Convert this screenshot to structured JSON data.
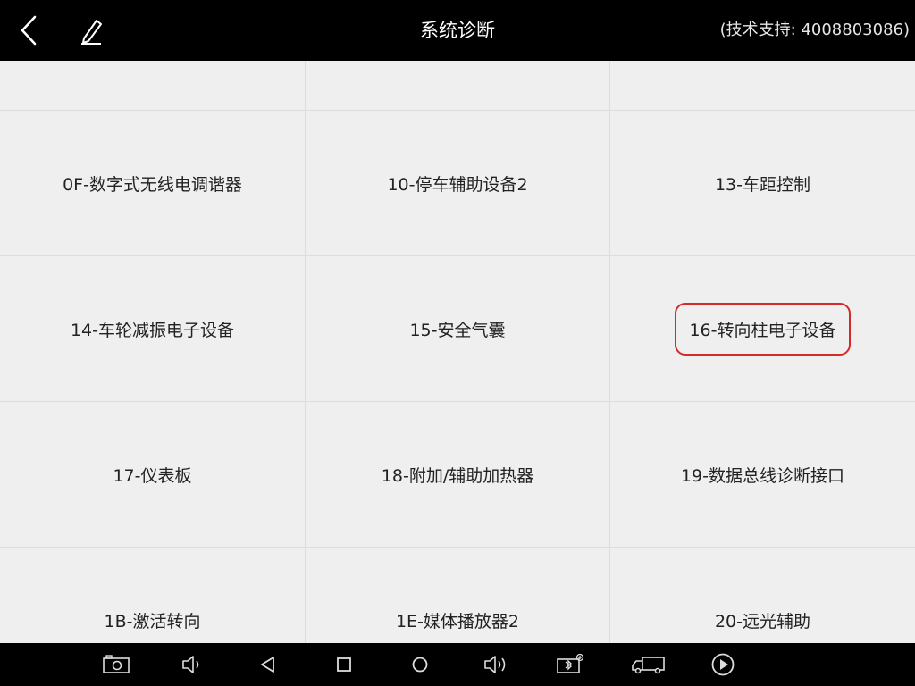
{
  "header": {
    "title": "系统诊断",
    "support": "(技术支持: 4008803086)",
    "back_icon": "chevron-left-icon",
    "edit_icon": "pencil-icon"
  },
  "grid": {
    "rows": [
      [
        "",
        "",
        ""
      ],
      [
        "0F-数字式无线电调谐器",
        "10-停车辅助设备2",
        "13-车距控制"
      ],
      [
        "14-车轮减振电子设备",
        "15-安全气囊",
        "16-转向柱电子设备"
      ],
      [
        "17-仪表板",
        "18-附加/辅助加热器",
        "19-数据总线诊断接口"
      ],
      [
        "1B-激活转向",
        "1E-媒体播放器2",
        "20-远光辅助"
      ]
    ],
    "selected": "16-转向柱电子设备",
    "selected_color": "#d32a2a"
  },
  "navbar": {
    "icons": [
      "screenshot-icon",
      "volume-down-icon",
      "back-triangle-icon",
      "recent-apps-icon",
      "home-circle-icon",
      "volume-up-icon",
      "vci-bluetooth-icon",
      "truck-icon",
      "play-circle-icon"
    ]
  },
  "colors": {
    "topbar": "#000000",
    "content_bg": "#efefef",
    "divider": "#dddddd",
    "accent": "#d32a2a"
  }
}
